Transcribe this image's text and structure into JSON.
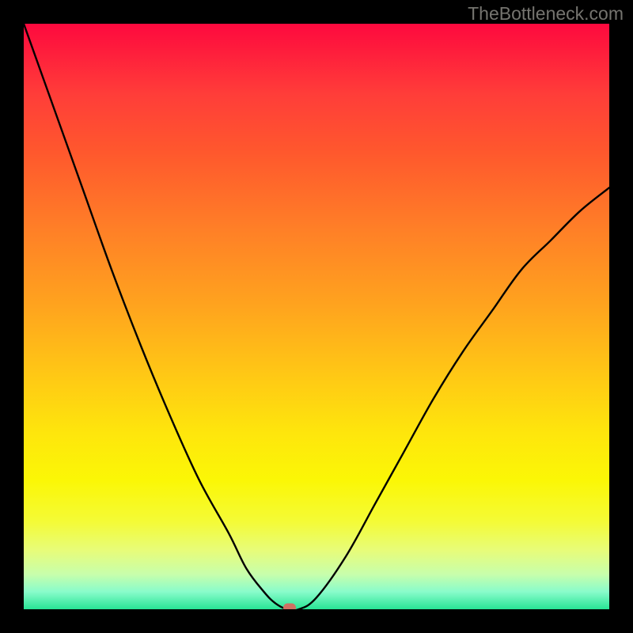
{
  "watermark": "TheBottleneck.com",
  "marker": {
    "x_frac": 0.454,
    "y_frac": 0.997
  },
  "chart_data": {
    "type": "line",
    "title": "",
    "xlabel": "",
    "ylabel": "",
    "xlim": [
      0,
      100
    ],
    "ylim": [
      0,
      100
    ],
    "annotations": [
      "TheBottleneck.com"
    ],
    "gradient_background": true,
    "series": [
      {
        "name": "bottleneck-curve",
        "x": [
          0,
          5,
          10,
          15,
          20,
          25,
          30,
          35,
          38,
          41,
          43,
          45,
          47,
          50,
          55,
          60,
          65,
          70,
          75,
          80,
          85,
          90,
          95,
          100
        ],
        "values": [
          100,
          86,
          72,
          58,
          45,
          33,
          22,
          13,
          7,
          3,
          1,
          0,
          0,
          2,
          9,
          18,
          27,
          36,
          44,
          51,
          58,
          63,
          68,
          72
        ]
      }
    ],
    "marker": {
      "x": 45.4,
      "y": 0.3,
      "color": "#cf7163"
    }
  }
}
